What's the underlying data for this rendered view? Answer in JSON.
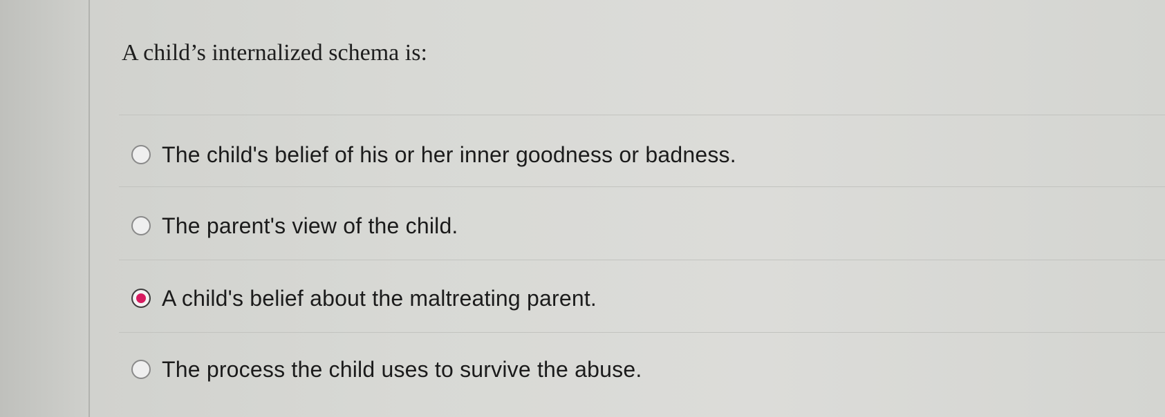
{
  "question": {
    "text": "A child’s internalized schema is:"
  },
  "options": [
    {
      "label": "The child's belief of his or her inner goodness or badness.",
      "selected": false
    },
    {
      "label": "The parent's view of the child.",
      "selected": false
    },
    {
      "label": "A child's belief about the maltreating parent.",
      "selected": true
    },
    {
      "label": "The process the child uses to survive the abuse.",
      "selected": false
    }
  ],
  "colors": {
    "selected_radio": "#d81b60",
    "background": "#d8d9d5"
  }
}
